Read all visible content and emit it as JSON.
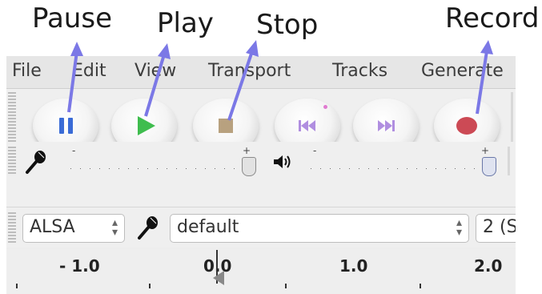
{
  "annotations": {
    "pause": "Pause",
    "play": "Play",
    "stop": "Stop",
    "record": "Record"
  },
  "menu": {
    "items": [
      "File",
      "Edit",
      "View",
      "Transport",
      "Tracks",
      "Generate"
    ]
  },
  "meters": {
    "input_min": "-",
    "input_max": "+",
    "output_min": "-",
    "output_max": "+"
  },
  "devices": {
    "host": "ALSA",
    "recording_device": "default",
    "channels": "2 (S"
  },
  "ruler": {
    "labels": [
      "- 1.0",
      "0.0",
      "1.0",
      "2.0"
    ]
  },
  "colors": {
    "arrow": "#7b78e6",
    "play": "#3fbd4e",
    "pause": "#3a6bd6",
    "stop": "#b8a17f",
    "record": "#cc4a55",
    "skip": "#b08ee0"
  },
  "icons": {
    "pause": "pause-icon",
    "play": "play-icon",
    "stop": "stop-icon",
    "skip_start": "skip-to-start-icon",
    "skip_end": "skip-to-end-icon",
    "record": "record-icon",
    "microphone": "microphone-icon",
    "speaker": "speaker-icon"
  }
}
